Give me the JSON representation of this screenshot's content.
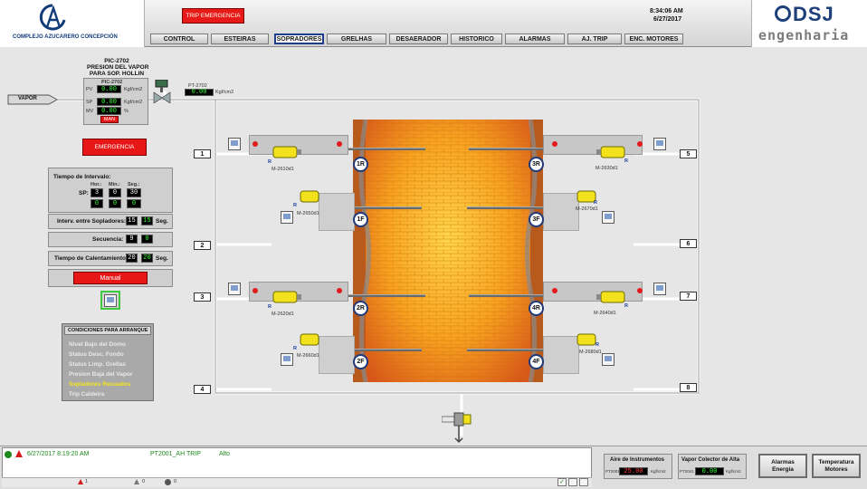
{
  "header": {
    "company": "COMPLEJO AZUCARERO CONCEPCIÓN",
    "brand_name": "DSJ",
    "brand_sub": "engenharia",
    "trip_button": "TRIP EMERGENCIA",
    "time": "8:34:06 AM",
    "date": "6/27/2017",
    "tabs": [
      "CONTROL",
      "ESTEIRAS",
      "SOPRADORES",
      "GRELHAS",
      "DESAERADOR",
      "HISTORICO",
      "ALARMAS",
      "AJ. TRIP",
      "ENC. MOTORES"
    ],
    "active_tab": "SOPRADORES"
  },
  "pic": {
    "title_1": "PIC-2702",
    "title_2": "PRESION DEL VAPOR",
    "title_3": "PARA SOP. HOLLIN",
    "inner_title": "PIC-2702",
    "pv_label": "PV",
    "pv_value": "0.00",
    "sp_label": "SP",
    "sp_value": "0.00",
    "mv_label": "MV",
    "mv_value": "0.00",
    "unit": "Kgf/cm2",
    "mv_unit": "%",
    "mode": "MAN",
    "vapor_label": "VAPOR",
    "pt_tag": "PT-2702",
    "pt_value": "0.00",
    "pt_unit": "Kgf/cm2"
  },
  "left": {
    "emergency_button": "EMERGENCIA",
    "interval_title": "Tiempo de Intervalo:",
    "hor_label": "Hor.:",
    "min_label": "Min.:",
    "seg_label": "Seg.:",
    "sp_label": "SP:",
    "sp_hor": "3",
    "sp_min": "0",
    "sp_seg": "30",
    "act_hor": "0",
    "act_min": "0",
    "act_seg": "0",
    "interv_label": "Interv. entre Sopladores:",
    "interv_sp": "15",
    "interv_act": "15",
    "interv_unit": "Seg.",
    "seq_label": "Secuencia:",
    "seq_sp": "9",
    "seq_act": "0",
    "heat_label": "Tiempo de Calentamiento:",
    "heat_sp": "20",
    "heat_act": "20",
    "heat_unit": "Seg.",
    "manual_button": "Manual"
  },
  "conditions": {
    "title": "CONDICIONES PARA ARRANQUE",
    "items": [
      "Nivel Bajo del Domo",
      "Status Desc. Fondo",
      "Status Limp. Grellas",
      "Presion Baja del Vapor",
      "Sopladores Recuados",
      "Trip Caldeira"
    ],
    "highlight_color": "#f5e51c",
    "dim_color": "#e9e9e9"
  },
  "sides": {
    "left_numbers": [
      "1",
      "2",
      "3",
      "4"
    ],
    "right_numbers": [
      "5",
      "6",
      "7",
      "8"
    ]
  },
  "blowers": {
    "r1": {
      "circle": "1R",
      "motor": "M-2610d1",
      "r": "R"
    },
    "f1": {
      "circle": "1F",
      "motor": "M-2650d1",
      "r": "R"
    },
    "r2": {
      "circle": "2R",
      "motor": "M-2620d1",
      "r": "R"
    },
    "f2": {
      "circle": "2F",
      "motor": "M-2660d1",
      "r": "R"
    },
    "r3": {
      "circle": "3R",
      "motor": "M-2630d1",
      "r": "R"
    },
    "f3": {
      "circle": "3F",
      "motor": "M-2670d1",
      "r": "R"
    },
    "r4": {
      "circle": "4R",
      "motor": "M-2640d1",
      "r": "R"
    },
    "f4": {
      "circle": "4F",
      "motor": "M-2680d1",
      "r": "R"
    }
  },
  "footer": {
    "alarm_time": "6/27/2017 8:19:20 AM",
    "alarm_tag": "PT2001_AH TRIP",
    "alarm_level": "Alto",
    "count_a": "1",
    "count_b": "0",
    "count_c": "0",
    "air_title": "Aire de Instrumentos",
    "air_tag": "PT2001",
    "air_value": "25.00",
    "air_unit": "Kgf/cm2",
    "steam_title": "Vapor Colector de Alta",
    "steam_tag": "PT2041",
    "steam_value": "0.00",
    "steam_unit": "Kgf/cm2",
    "btn_alarmas": "Alarmas Energia",
    "btn_temp": "Temperatura Motores"
  }
}
